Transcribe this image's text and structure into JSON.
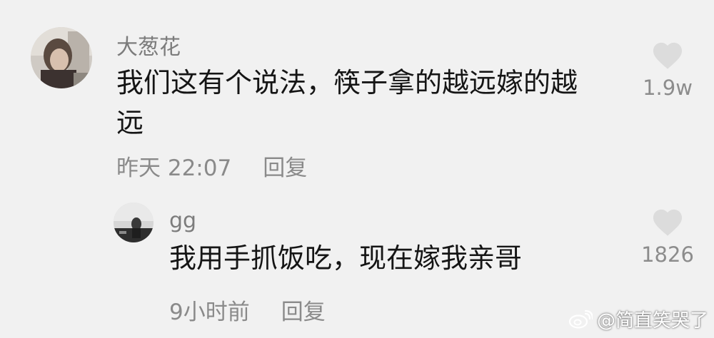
{
  "comments": [
    {
      "username": "大葱花",
      "text_line1": "我们这有个说法，筷子拿的越远嫁的越",
      "text_line2": "远",
      "time": "昨天 22:07",
      "reply_label": "回复",
      "likes": "1.9w"
    },
    {
      "username": "gg",
      "text_line1": "我用手抓饭吃，现在嫁我亲哥",
      "time": "9小时前",
      "reply_label": "回复",
      "likes": "1826"
    }
  ],
  "watermark": {
    "text": "@简直笑哭了"
  },
  "icons": {
    "like": "heart-icon",
    "avatar": "avatar"
  },
  "colors": {
    "background": "#f1f1f1",
    "username": "#7c7c7c",
    "meta": "#8a8a8a",
    "heart": "#dcdcdc"
  }
}
